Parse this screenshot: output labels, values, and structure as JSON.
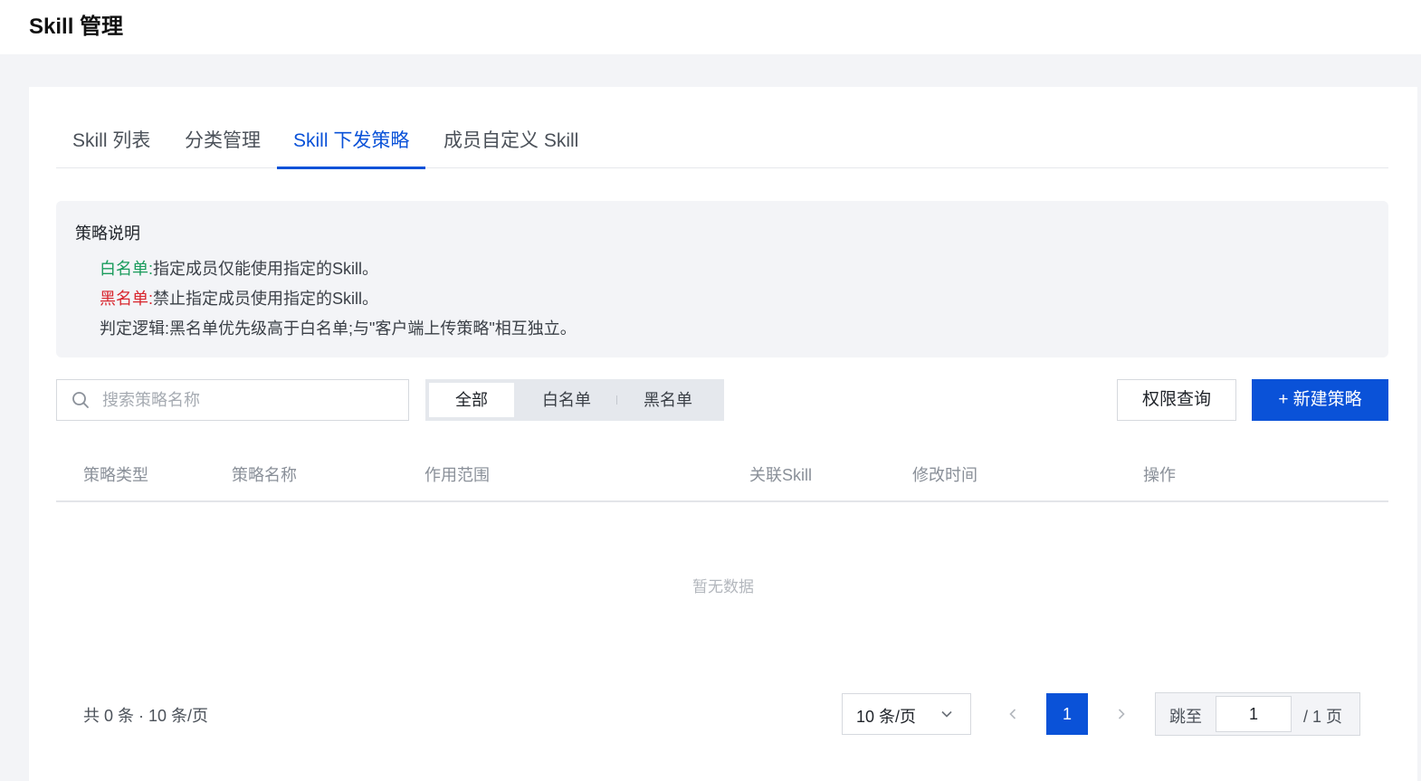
{
  "header": {
    "title": "Skill 管理"
  },
  "tabs": [
    {
      "label": "Skill 列表",
      "active": false
    },
    {
      "label": "分类管理",
      "active": false
    },
    {
      "label": "Skill 下发策略",
      "active": true
    },
    {
      "label": "成员自定义 Skill",
      "active": false
    }
  ],
  "note": {
    "title": "策略说明",
    "whitelist_tag": "白名单:",
    "whitelist_text": "指定成员仅能使用指定的Skill。",
    "blacklist_tag": "黑名单:",
    "blacklist_text": "禁止指定成员使用指定的Skill。",
    "logic_text": "判定逻辑:黑名单优先级高于白名单;与\"客户端上传策略\"相互独立。"
  },
  "toolbar": {
    "search_placeholder": "搜索策略名称",
    "search_value": "",
    "filters": [
      {
        "label": "全部",
        "active": true
      },
      {
        "label": "白名单",
        "active": false
      },
      {
        "label": "黑名单",
        "active": false
      }
    ],
    "query_button": "权限查询",
    "new_button": "+ 新建策略"
  },
  "table": {
    "columns": [
      "策略类型",
      "策略名称",
      "作用范围",
      "关联Skill",
      "修改时间",
      "操作"
    ],
    "rows": [],
    "empty_text": "暂无数据"
  },
  "pagination": {
    "total_text": "共 0 条 · 10 条/页",
    "page_size": "10 条/页",
    "current_page": "1",
    "jump_label": "跳至",
    "jump_value": "1",
    "total_pages_text": "/ 1 页"
  },
  "colors": {
    "accent": "#0a52d8",
    "whitelist": "#1a9b5c",
    "blacklist": "#d8262e"
  },
  "icons": {
    "search": "search-icon",
    "chevron_down": "chevron-down-icon",
    "prev": "chevron-left-icon",
    "next": "chevron-right-icon"
  }
}
